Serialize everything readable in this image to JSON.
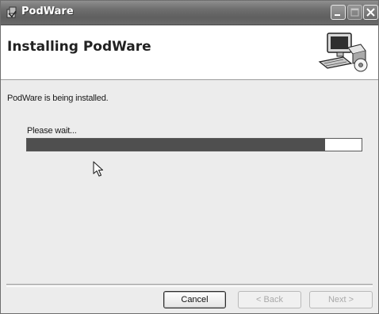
{
  "window": {
    "title": "PodWare",
    "icon": "installer-icon"
  },
  "header": {
    "title": "Installing PodWare",
    "graphic": "computer-install-icon"
  },
  "main": {
    "status_text": "PodWare is being installed.",
    "wait_text": "Please wait...",
    "progress_fraction": 0.89
  },
  "buttons": {
    "cancel": "Cancel",
    "back": "< Back",
    "next": "Next >"
  },
  "colors": {
    "progress_fill": "#4f4f4f",
    "header_bg": "#ffffff",
    "window_bg": "#ececec"
  }
}
